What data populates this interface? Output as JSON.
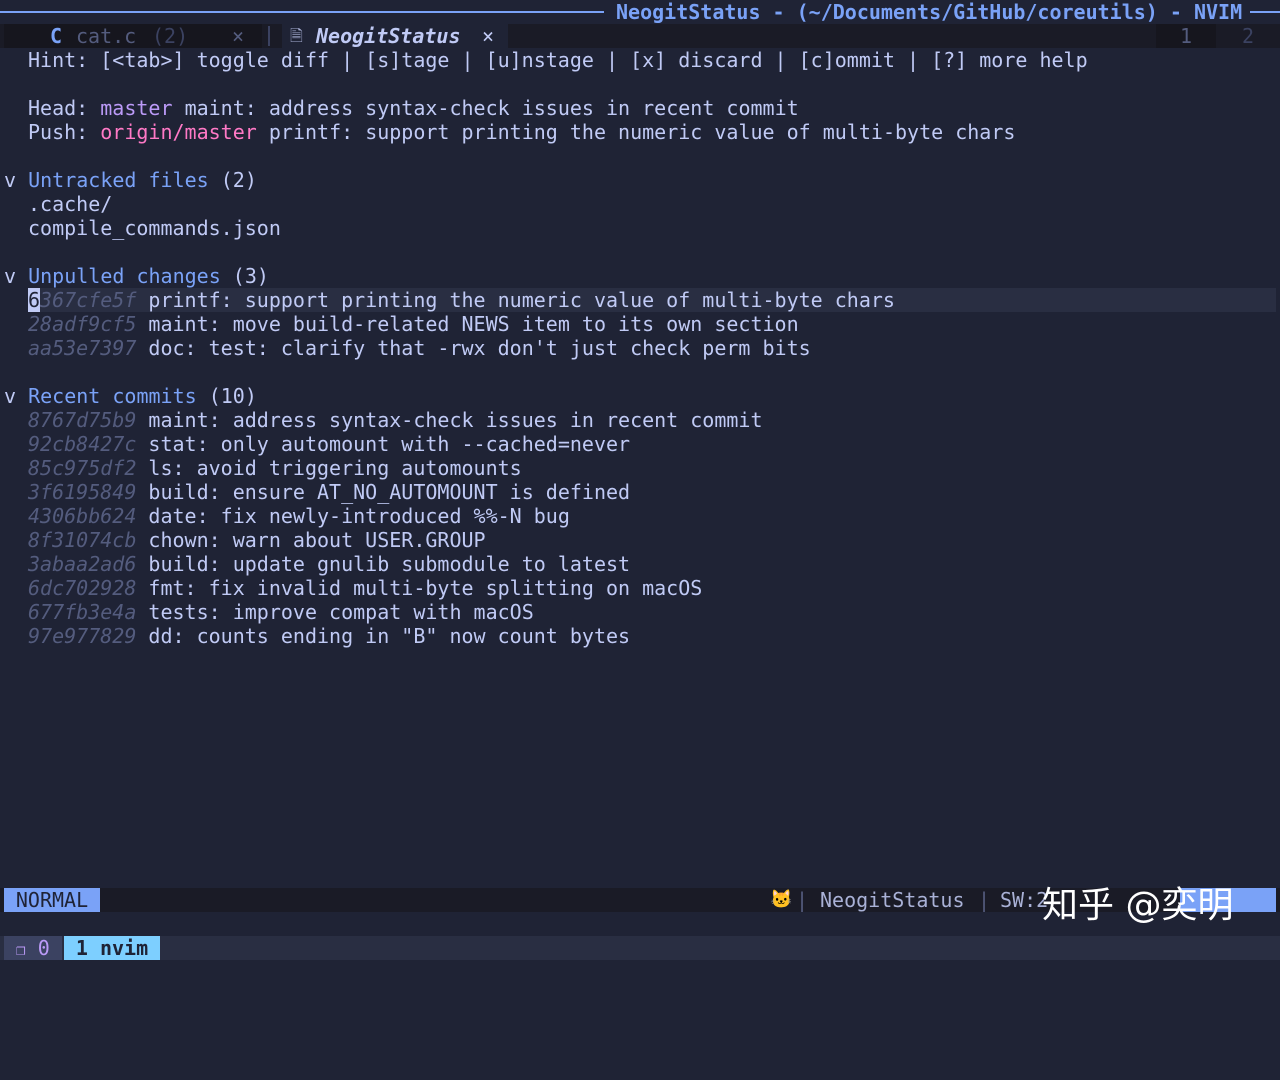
{
  "window_title": "NeogitStatus - (~/Documents/GitHub/coreutils) - NVIM",
  "tabs": [
    {
      "label": "cat.c",
      "badge": "(2)",
      "close": "×",
      "icon": "c-file-icon"
    },
    {
      "label": "NeogitStatus",
      "close": "×",
      "icon": "document-icon"
    }
  ],
  "tab_numbers": [
    "1",
    "2"
  ],
  "hint": "Hint: [<tab>] toggle diff | [s]tage | [u]nstage | [x] discard | [c]ommit | [?] more help",
  "head": {
    "label": "Head:",
    "branch": "master",
    "message": "maint: address syntax-check issues in recent commit"
  },
  "push": {
    "label": "Push:",
    "branch": "origin/master",
    "message": "printf: support printing the numeric value of multi-byte chars"
  },
  "untracked": {
    "fold": "v",
    "title": "Untracked files",
    "count": "(2)",
    "files": [
      ".cache/",
      "compile_commands.json"
    ]
  },
  "unpulled": {
    "fold": "v",
    "title": "Unpulled changes",
    "count": "(3)",
    "commits": [
      {
        "hash_first": "6",
        "hash_rest": "367cfe5f",
        "message": "printf: support printing the numeric value of multi-byte chars"
      },
      {
        "hash": "28adf9cf5",
        "message": "maint: move build-related NEWS item to its own section"
      },
      {
        "hash": "aa53e7397",
        "message": "doc: test: clarify that -rwx don't just check perm bits"
      }
    ]
  },
  "recent": {
    "fold": "v",
    "title": "Recent commits",
    "count": "(10)",
    "commits": [
      {
        "hash": "8767d75b9",
        "message": "maint: address syntax-check issues in recent commit"
      },
      {
        "hash": "92cb8427c",
        "message": "stat: only automount with --cached=never"
      },
      {
        "hash": "85c975df2",
        "message": "ls: avoid triggering automounts"
      },
      {
        "hash": "3f6195849",
        "message": "build: ensure AT_NO_AUTOMOUNT is defined"
      },
      {
        "hash": "4306bb624",
        "message": "date: fix newly-introduced %%-N bug"
      },
      {
        "hash": "8f31074cb",
        "message": "chown: warn about USER.GROUP"
      },
      {
        "hash": "3abaa2ad6",
        "message": "build: update gnulib submodule to latest"
      },
      {
        "hash": "6dc702928",
        "message": "fmt: fix invalid multi-byte splitting on macOS"
      },
      {
        "hash": "677fb3e4a",
        "message": "tests: improve compat with macOS"
      },
      {
        "hash": "97e977829",
        "message": "dd: counts ending in \"B\" now count bytes"
      }
    ]
  },
  "statusline": {
    "mode": "NORMAL",
    "icon": "github-cat-icon",
    "filetype": "NeogitStatus",
    "sep": "|",
    "sw": "SW:2"
  },
  "tmux": {
    "session": "0",
    "window": "1 nvim"
  },
  "watermark": "知乎 @奕明",
  "colors": {
    "accent": "#7aa2f7",
    "background": "#1f2335",
    "head_branch": "#bb9af7",
    "push_branch": "#ff79c6"
  }
}
